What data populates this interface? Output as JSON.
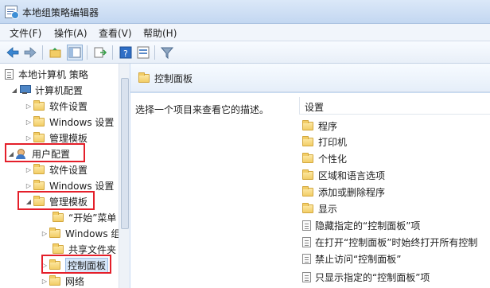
{
  "window": {
    "title": "本地组策略编辑器"
  },
  "menu": [
    "文件(F)",
    "操作(A)",
    "查看(V)",
    "帮助(H)"
  ],
  "toolbar": {
    "buttons": [
      "back-arrow-icon",
      "forward-arrow-icon",
      "up-folder-icon",
      "show-hide-tree-icon",
      "export-list-icon",
      "help-icon",
      "properties-icon",
      "filter-icon"
    ]
  },
  "tree": {
    "root": "本地计算机 策略",
    "computer_config": "计算机配置",
    "computer_children": [
      "软件设置",
      "Windows 设置",
      "管理模板"
    ],
    "user_config": "用户配置",
    "user_children": [
      "软件设置",
      "Windows 设置",
      "管理模板"
    ],
    "admin_children": [
      "“开始”菜单",
      "Windows 组",
      "共享文件夹",
      "控制面板",
      "网络"
    ]
  },
  "right": {
    "header": "控制面板",
    "description": "选择一个项目来查看它的描述。",
    "column_header": "设置",
    "folders": [
      "程序",
      "打印机",
      "个性化",
      "区域和语言选项",
      "添加或删除程序",
      "显示"
    ],
    "policies": [
      "隐藏指定的“控制面板”项",
      "在打开“控制面板”时始终打开所有控制",
      "禁止访问“控制面板”",
      "只显示指定的“控制面板”项"
    ]
  },
  "colors": {
    "highlight": "#e41f2a",
    "folder": "#f2cd66"
  }
}
